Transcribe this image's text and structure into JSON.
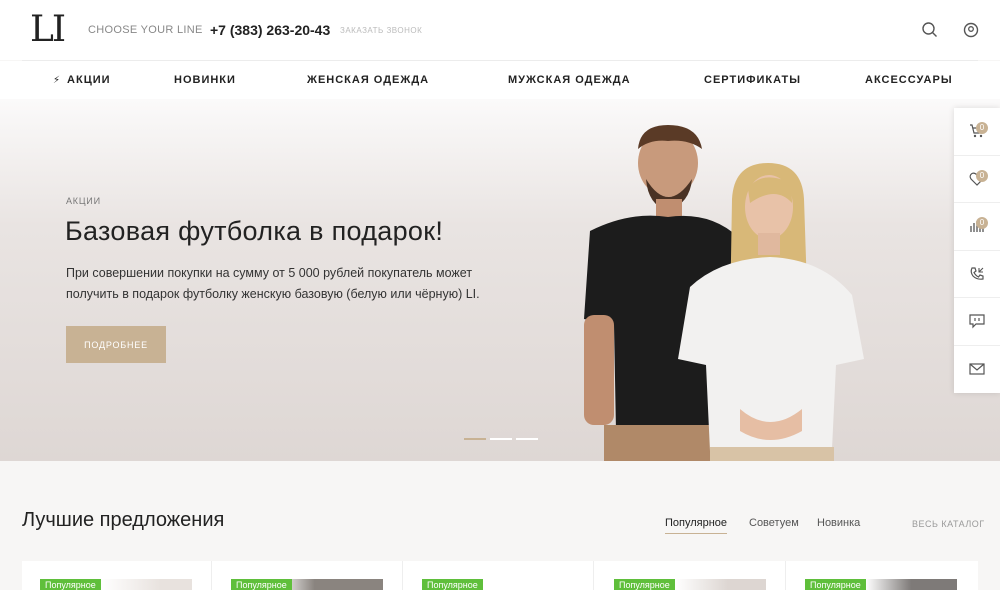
{
  "header": {
    "logo": "LI",
    "tagline": "CHOOSE YOUR LINE",
    "phone": "+7 (383) 263-20-43",
    "callback_label": "ЗАКАЗАТЬ ЗВОНОК",
    "icons": [
      "search-icon",
      "user-icon"
    ]
  },
  "nav": {
    "items": [
      {
        "label": "АКЦИИ",
        "icon": "bolt-icon"
      },
      {
        "label": "НОВИНКИ"
      },
      {
        "label": "ЖЕНСКАЯ ОДЕЖДА"
      },
      {
        "label": "МУЖСКАЯ ОДЕЖДА"
      },
      {
        "label": "СЕРТИФИКАТЫ"
      },
      {
        "label": "АКСЕССУАРЫ"
      }
    ]
  },
  "hero": {
    "kicker": "АКЦИИ",
    "title": "Базовая футболка в подарок!",
    "text_line1": "При совершении покупки на сумму от 5 000 рублей покупатель может",
    "text_line2": "получить в подарок футболку женскую базовую (белую или чёрную) LI.",
    "button_label": "ПОДРОБНЕЕ",
    "slide_count": 3,
    "active_slide": 1
  },
  "side_panel": {
    "items": [
      {
        "icon": "cart-icon",
        "badge": "0"
      },
      {
        "icon": "heart-icon",
        "badge": "0"
      },
      {
        "icon": "compare-icon",
        "badge": "0"
      },
      {
        "icon": "phone-callback-icon"
      },
      {
        "icon": "chat-icon"
      },
      {
        "icon": "mail-icon"
      }
    ]
  },
  "offers": {
    "title": "Лучшие предложения",
    "tabs": [
      "Популярное",
      "Советуем",
      "Новинка"
    ],
    "active_tab": "Популярное",
    "all_catalog": "ВЕСЬ КАТАЛОГ",
    "card_tag": "Популярное",
    "card_count": 5
  },
  "colors": {
    "accent": "#c8b294",
    "tag_green": "#5fbf3b"
  }
}
